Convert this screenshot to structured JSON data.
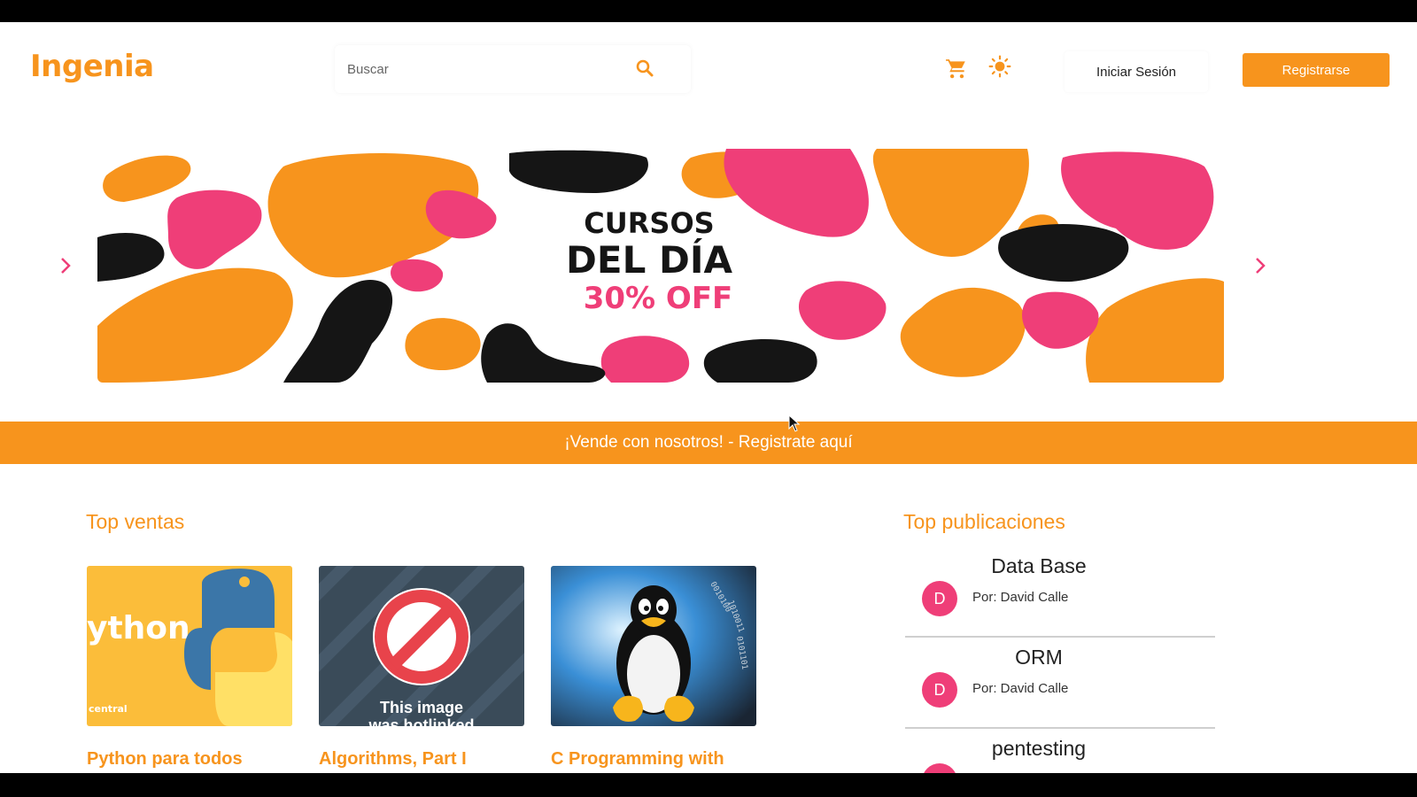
{
  "header": {
    "logo": "Ingenia",
    "search_placeholder": "Buscar",
    "login_label": "Iniciar Sesión",
    "register_label": "Registrarse"
  },
  "banner": {
    "line1": "CURSOS",
    "line2": "DEL DÍA",
    "line3": "30% OFF"
  },
  "promo_strip": "¡Vende con nosotros! - Registrate aquí",
  "top_sales": {
    "title": "Top ventas",
    "courses": [
      {
        "title": "Python para todos",
        "thumb_text": "ython",
        "thumb_sub": "central"
      },
      {
        "title": "Algorithms, Part I",
        "thumb_text": "This image",
        "thumb_sub": "was hotlinked"
      },
      {
        "title": "C Programming with",
        "thumb_text": "",
        "thumb_sub": ""
      }
    ]
  },
  "top_posts": {
    "title": "Top publicaciones",
    "items": [
      {
        "avatar": "D",
        "title": "Data Base",
        "author": "Por: David Calle"
      },
      {
        "avatar": "D",
        "title": "ORM",
        "author": "Por: David Calle"
      },
      {
        "avatar": "",
        "title": "pentesting",
        "author": ""
      }
    ]
  },
  "colors": {
    "accent": "#f7941d",
    "pink": "#ef3e78",
    "banner_black": "#151515"
  },
  "icons": [
    "search-icon",
    "cart-icon",
    "sun-icon",
    "chevron-left-icon",
    "chevron-right-icon",
    "cursor-icon"
  ]
}
